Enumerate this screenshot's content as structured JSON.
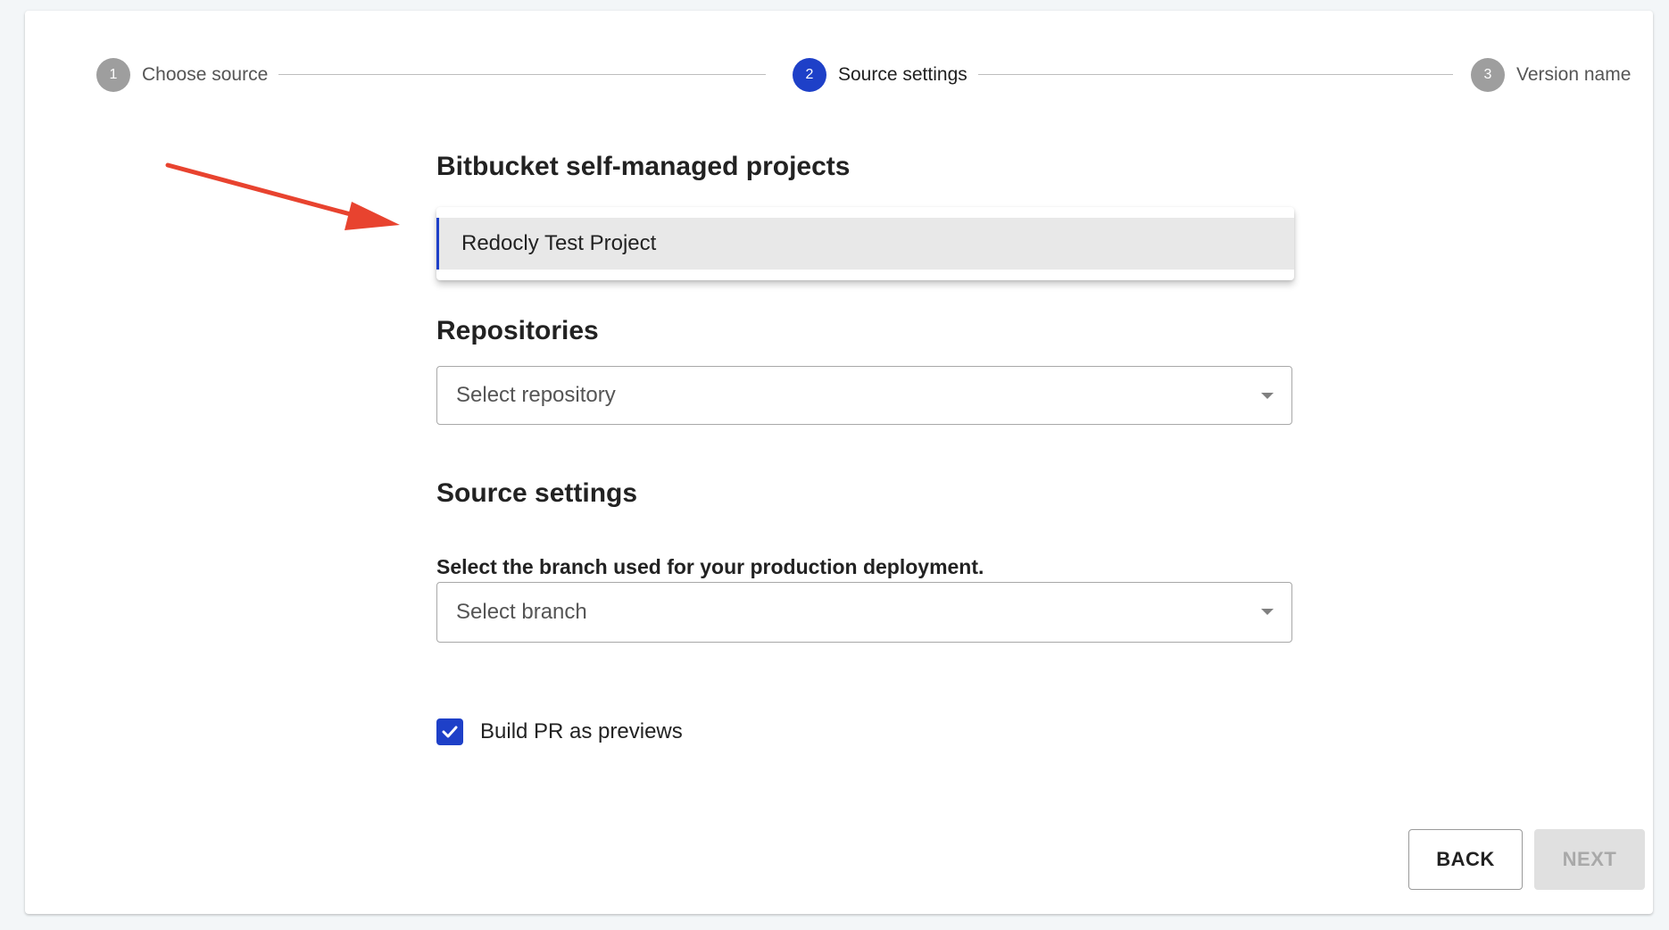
{
  "stepper": {
    "steps": [
      {
        "number": "1",
        "label": "Choose source",
        "state": "inactive"
      },
      {
        "number": "2",
        "label": "Source settings",
        "state": "active"
      },
      {
        "number": "3",
        "label": "Version name",
        "state": "inactive"
      }
    ]
  },
  "form": {
    "projects_title": "Bitbucket self-managed projects",
    "projects_selected_option": "Redocly Test Project",
    "repositories_title": "Repositories",
    "repository_placeholder": "Select repository",
    "source_settings_title": "Source settings",
    "branch_label": "Select the branch used for your production deployment.",
    "branch_placeholder": "Select branch",
    "build_pr_label": "Build PR as previews",
    "build_pr_checked": true
  },
  "actions": {
    "back_label": "BACK",
    "next_label": "NEXT",
    "next_disabled": true
  },
  "colors": {
    "accent": "#1e40c8",
    "annotation_arrow": "#e8432f",
    "inactive_step": "#9e9e9e"
  }
}
